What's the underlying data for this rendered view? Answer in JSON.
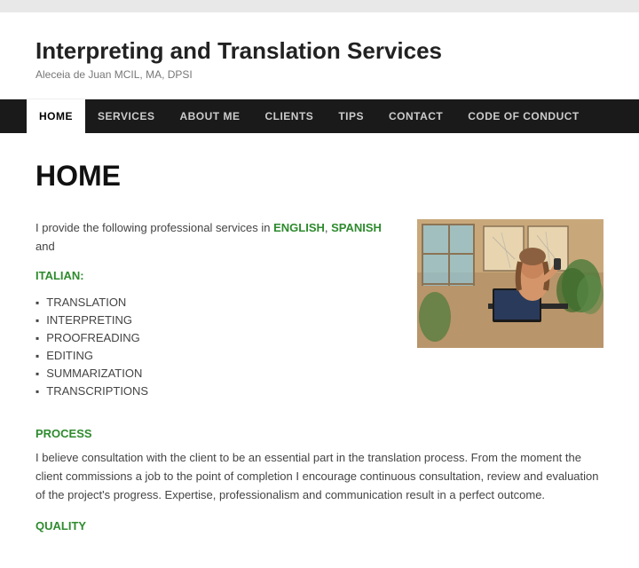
{
  "site": {
    "title": "Interpreting and Translation Services",
    "subtitle": "Aleceia de Juan MCIL, MA, DPSI"
  },
  "nav": {
    "items": [
      {
        "label": "HOME",
        "active": true
      },
      {
        "label": "SERVICES",
        "active": false
      },
      {
        "label": "ABOUT ME",
        "active": false
      },
      {
        "label": "CLIENTS",
        "active": false
      },
      {
        "label": "TIPS",
        "active": false
      },
      {
        "label": "CONTACT",
        "active": false
      },
      {
        "label": "CODE OF CONDUCT",
        "active": false
      }
    ]
  },
  "main": {
    "heading": "HOME",
    "intro_prefix": "I provide the following professional services in ",
    "intro_english": "ENGLISH",
    "intro_comma": ", ",
    "intro_spanish": "SPANISH",
    "intro_and": " and",
    "intro_italian": "ITALIAN:",
    "services": [
      "TRANSLATION",
      "INTERPRETING",
      "PROOFREADING",
      "EDITING",
      "SUMMARIZATION",
      "TRANSCRIPTIONS"
    ],
    "process_heading": "PROCESS",
    "process_text": "I believe consultation with the client to be an essential part in the translation process. From the moment the client commissions a job to the point of completion I encourage continuous consultation, review and evaluation of the project's progress.  Expertise, professionalism and communication result in a perfect outcome.",
    "quality_heading": "QUALITY"
  },
  "colors": {
    "green": "#2e8b2e",
    "nav_bg": "#1a1a1a",
    "active_nav": "#ffffff"
  }
}
